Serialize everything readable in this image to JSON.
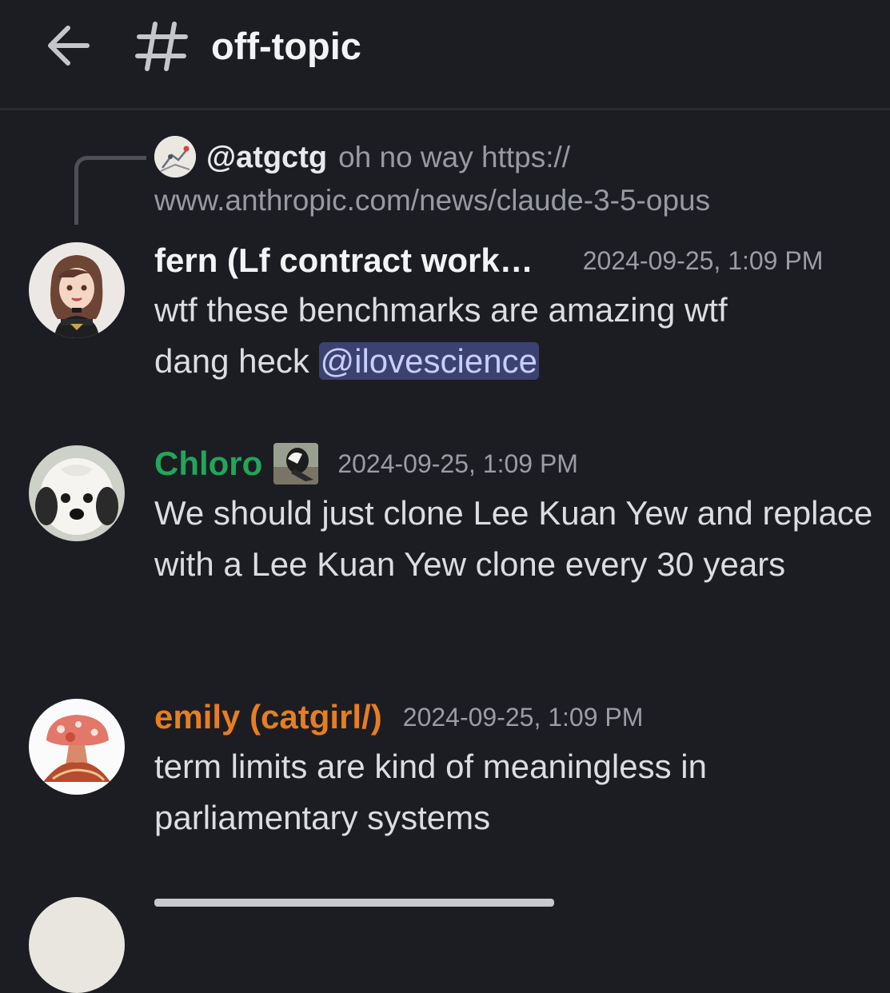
{
  "header": {
    "channel_name": "off-topic"
  },
  "reply": {
    "username": "@atgctg",
    "text_line1": "oh no way https://",
    "text_line2": "www.anthropic.com/news/claude-3-5-opus"
  },
  "messages": [
    {
      "username": "fern (Lf contract work…",
      "username_color": "#f2f3f5",
      "timestamp": "2024-09-25, 1:09 PM",
      "text": "wtf these benchmarks are amazing wtf dang heck ",
      "mention": "@ilovescience"
    },
    {
      "username": "Chloro",
      "username_color": "#23a55a",
      "timestamp": "2024-09-25, 1:09 PM",
      "text": "We should just clone Lee Kuan Yew and replace with a Lee Kuan Yew clone every 30 years"
    },
    {
      "username": "emily (catgirl/)",
      "username_color": "#e67e22",
      "timestamp": "2024-09-25, 1:09 PM",
      "text": "term limits are kind of meaningless in parliamentary systems"
    }
  ],
  "colors": {
    "background": "#1c1d22",
    "mention_bg": "#3c4270",
    "mention_text": "#c9cdfb",
    "timestamp": "#9b9da5"
  }
}
